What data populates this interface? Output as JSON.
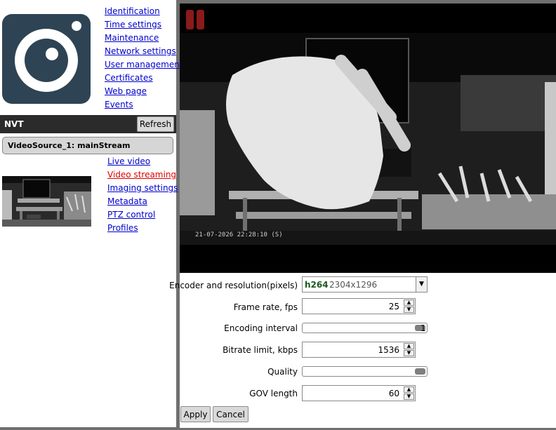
{
  "nav": {
    "links": [
      "Identification",
      "Time settings",
      "Maintenance",
      "Network settings",
      "User management",
      "Certificates",
      "Web page",
      "Events"
    ]
  },
  "device": {
    "title": "NVT",
    "refresh_label": "Refresh",
    "source_label": "VideoSource_1: mainStream"
  },
  "source_menu": {
    "links": [
      "Live video",
      "Video streaming",
      "Imaging settings",
      "Metadata",
      "PTZ control",
      "Profiles"
    ],
    "active": "Video streaming"
  },
  "video": {
    "timestamp": "21-07-2026 22:28:10 (S)"
  },
  "form": {
    "encoder_label": "Encoder and resolution(pixels)",
    "encoder_value": "h264",
    "resolution_value": "2304x1296",
    "framerate_label": "Frame rate, fps",
    "framerate_value": "25",
    "encoding_interval_label": "Encoding interval",
    "encoding_interval_value": "1",
    "encoding_interval_level": 1.0,
    "bitrate_label": "Bitrate limit, kbps",
    "bitrate_value": "1536",
    "quality_label": "Quality",
    "quality_level": 1.0,
    "gov_label": "GOV length",
    "gov_value": "60"
  },
  "actions": {
    "apply_label": "Apply",
    "cancel_label": "Cancel"
  },
  "colors": {
    "link": "#0000cc",
    "active_link": "#dd0000",
    "logo": "#2e4454",
    "encoder": "#1c5a1c"
  }
}
